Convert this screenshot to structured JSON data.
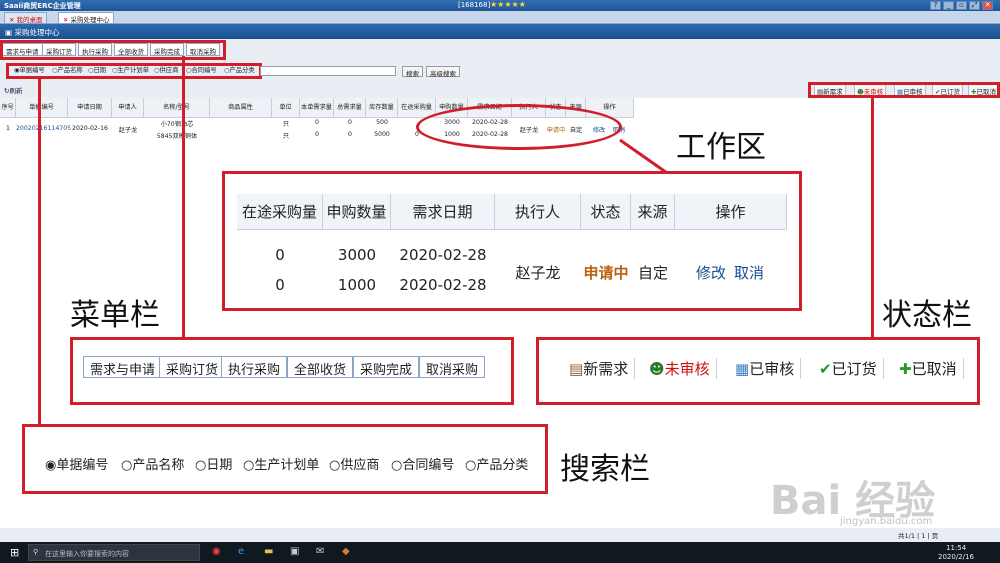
{
  "window": {
    "title": "Saaii商贸ERC企业管理",
    "user": "[168168]",
    "stars": "★★★★★",
    "controls": [
      "?",
      "_",
      "▫",
      "⤢",
      "✕"
    ]
  },
  "top_tabs": [
    {
      "label": "我的桌面"
    },
    {
      "label": "采购处理中心"
    }
  ],
  "module_title": "采购处理中心",
  "menu_tabs": [
    "需求与申请",
    "采购订货",
    "执行采购",
    "全部收货",
    "采购完成",
    "取消采购"
  ],
  "search_options": [
    "单据编号",
    "产品名称",
    "日期",
    "生产计划单",
    "供应商",
    "合同编号",
    "产品分类"
  ],
  "search_buttons": {
    "search": "搜索",
    "advanced": "高级搜索"
  },
  "refresh_label": "刷新",
  "status_items": [
    {
      "label": "新需求",
      "icon": "clipboard-icon"
    },
    {
      "label": "未审核",
      "icon": "users-icon",
      "color": "#d01010"
    },
    {
      "label": "已审核",
      "icon": "approved-doc-icon"
    },
    {
      "label": "已订货",
      "icon": "check-circle-icon"
    },
    {
      "label": "已取消",
      "icon": "plus-icon"
    }
  ],
  "table": {
    "headers": [
      "序号",
      "单据编号",
      "申请日期",
      "申请人",
      "名称/型号",
      "商品属性",
      "单位",
      "本单需求量",
      "总需求量",
      "库存数量",
      "在途采购量",
      "申购数量",
      "需求日期",
      "执行人",
      "状态",
      "来源",
      "操作"
    ],
    "row": {
      "index": "1",
      "doc_no": "20020216114705",
      "apply_date": "2020-02-16",
      "applicant": "赵子龙",
      "items": [
        {
          "name": "小70钢油芯",
          "unit": "只",
          "this_req": "0",
          "total_req": "0",
          "stock": "500",
          "in_transit": "",
          "purchase_qty": "3000",
          "need_date": "2020-02-28"
        },
        {
          "name": "5845双模铜体",
          "unit": "只",
          "this_req": "0",
          "total_req": "0",
          "stock": "5000",
          "in_transit": "0",
          "purchase_qty": "1000",
          "need_date": "2020-02-28"
        }
      ],
      "executor": "赵子龙",
      "status": "申请中",
      "source": "自定",
      "actions": [
        "修改",
        "取消"
      ]
    }
  },
  "zoom_table": {
    "headers": [
      "在途采购量",
      "申购数量",
      "需求日期",
      "执行人",
      "状态",
      "来源",
      "操作"
    ],
    "rows": [
      [
        "0",
        "3000",
        "2020-02-28"
      ],
      [
        "0",
        "1000",
        "2020-02-28"
      ]
    ],
    "executor": "赵子龙",
    "status": "申请中",
    "source": "自定",
    "actions": [
      "修改",
      "取消"
    ]
  },
  "annotations": {
    "workspace": "工作区",
    "menu_bar": "菜单栏",
    "status_bar": "状态栏",
    "search_bar": "搜索栏"
  },
  "pager": {
    "text": "共1/1 | 1 | 页"
  },
  "taskbar": {
    "search_placeholder": "在这里输入你要搜索的内容",
    "time": "11:54",
    "date": "2020/2/16"
  },
  "watermark": {
    "text": "Bai 经验",
    "sub": "jingyan.baidu.com"
  },
  "colors": {
    "accent": "#1f5597",
    "annotation": "#d21d2a",
    "pending": "#b8620e"
  }
}
